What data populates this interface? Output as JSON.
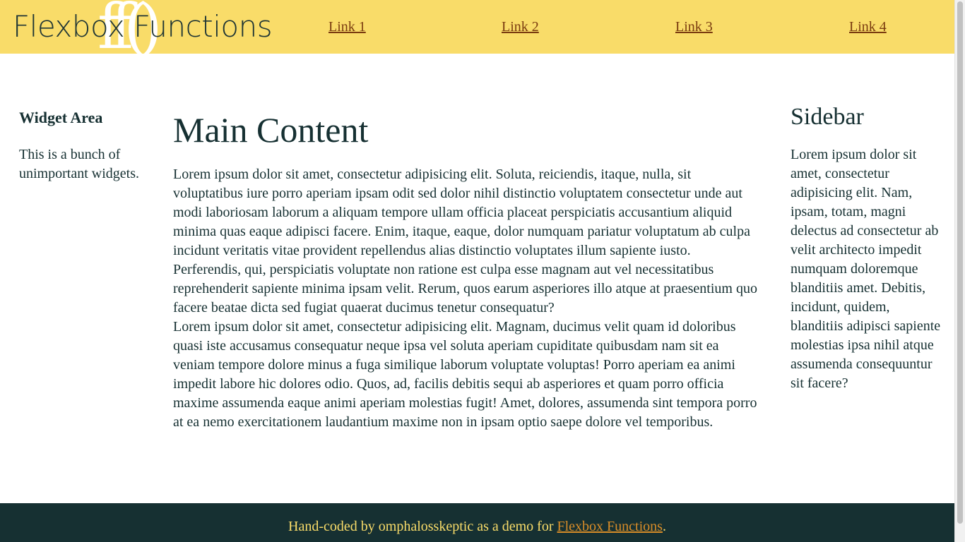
{
  "header": {
    "logo_text": "Flexbox Functions",
    "logo_mark": "ff()",
    "background": "#f9dc69",
    "nav": [
      {
        "label": "Link 1"
      },
      {
        "label": "Link 2"
      },
      {
        "label": "Link 3"
      },
      {
        "label": "Link 4"
      }
    ]
  },
  "widget_area": {
    "title": "Widget Area",
    "text": "This is a bunch of unimportant widgets."
  },
  "main": {
    "title": "Main Content",
    "paragraphs": [
      "Lorem ipsum dolor sit amet, consectetur adipisicing elit. Soluta, reiciendis, itaque, nulla, sit voluptatibus iure porro aperiam ipsam odit sed dolor nihil distinctio voluptatem consectetur unde aut modi laboriosam laborum a aliquam tempore ullam officia placeat perspiciatis accusantium aliquid minima quas eaque adipisci facere. Enim, itaque, eaque, dolor numquam pariatur voluptatum ab culpa incidunt veritatis vitae provident repellendus alias distinctio voluptates illum sapiente iusto. Perferendis, qui, perspiciatis voluptate non ratione est culpa esse magnam aut vel necessitatibus reprehenderit sapiente minima ipsam velit. Rerum, quos earum asperiores illo atque at praesentium quo facere beatae dicta sed fugiat quaerat ducimus tenetur consequatur?",
      "Lorem ipsum dolor sit amet, consectetur adipisicing elit. Magnam, ducimus velit quam id doloribus quasi iste accusamus consequatur neque ipsa vel soluta aperiam cupiditate quibusdam nam sit ea veniam tempore dolore minus a fuga similique laborum voluptate voluptas! Porro aperiam ea animi impedit labore hic dolores odio. Quos, ad, facilis debitis sequi ab asperiores et quam porro officia maxime assumenda eaque animi aperiam molestias fugit! Amet, dolores, assumenda sint tempora porro at ea nemo exercitationem laudantium maxime non in ipsam optio saepe dolore vel temporibus."
    ]
  },
  "sidebar": {
    "title": "Sidebar",
    "text": "Lorem ipsum dolor sit amet, consectetur adipisicing elit. Nam, ipsam, totam, magni delectus ad consectetur ab velit architecto impedit numquam doloremque blanditiis amet. Debitis, incidunt, quidem, blanditiis adipisci sapiente molestias ipsa nihil atque assumenda consequuntur sit facere?"
  },
  "footer": {
    "text_before": "Hand-coded by omphalosskeptic as a demo for ",
    "link_label": "Flexbox Functions",
    "text_after": ".",
    "background": "#163032",
    "text_color": "#f9dc69",
    "link_color": "#d98d28"
  }
}
